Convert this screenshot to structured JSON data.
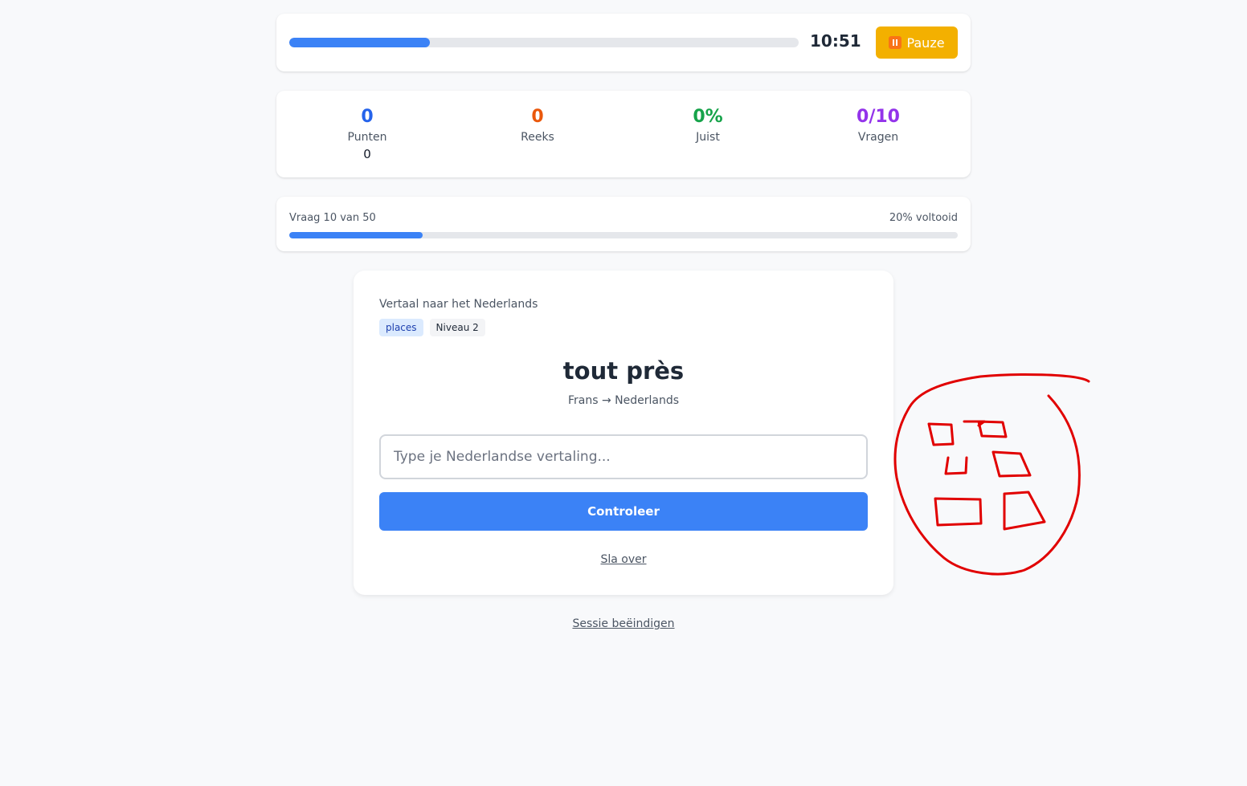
{
  "timer": {
    "progress_fraction": 0.276,
    "time": "10:51",
    "pause_label": "Pauze"
  },
  "stats": [
    {
      "value": "0",
      "label": "Punten",
      "sub": "0",
      "color": "#2563eb"
    },
    {
      "value": "0",
      "label": "Reeks",
      "sub": "",
      "color": "#ea580c"
    },
    {
      "value": "0%",
      "label": "Juist",
      "sub": "",
      "color": "#16a34a"
    },
    {
      "value": "0/10",
      "label": "Vragen",
      "sub": "",
      "color": "#9333ea"
    }
  ],
  "progress": {
    "left_text": "Vraag 10 van 50",
    "right_text": "20% voltooid",
    "fraction": 0.2
  },
  "question": {
    "instruction": "Vertaal naar het Nederlands",
    "tags": [
      "places",
      "Niveau 2"
    ],
    "word": "tout près",
    "direction": "Frans → Nederlands",
    "input_placeholder": "Type je Nederlandse vertaling...",
    "check_label": "Controleer",
    "skip_label": "Sla over"
  },
  "end_session_label": "Sessie beëindigen",
  "colors": {
    "accent": "#3b82f6",
    "pause": "#f3b000",
    "annotation": "#e10000"
  }
}
